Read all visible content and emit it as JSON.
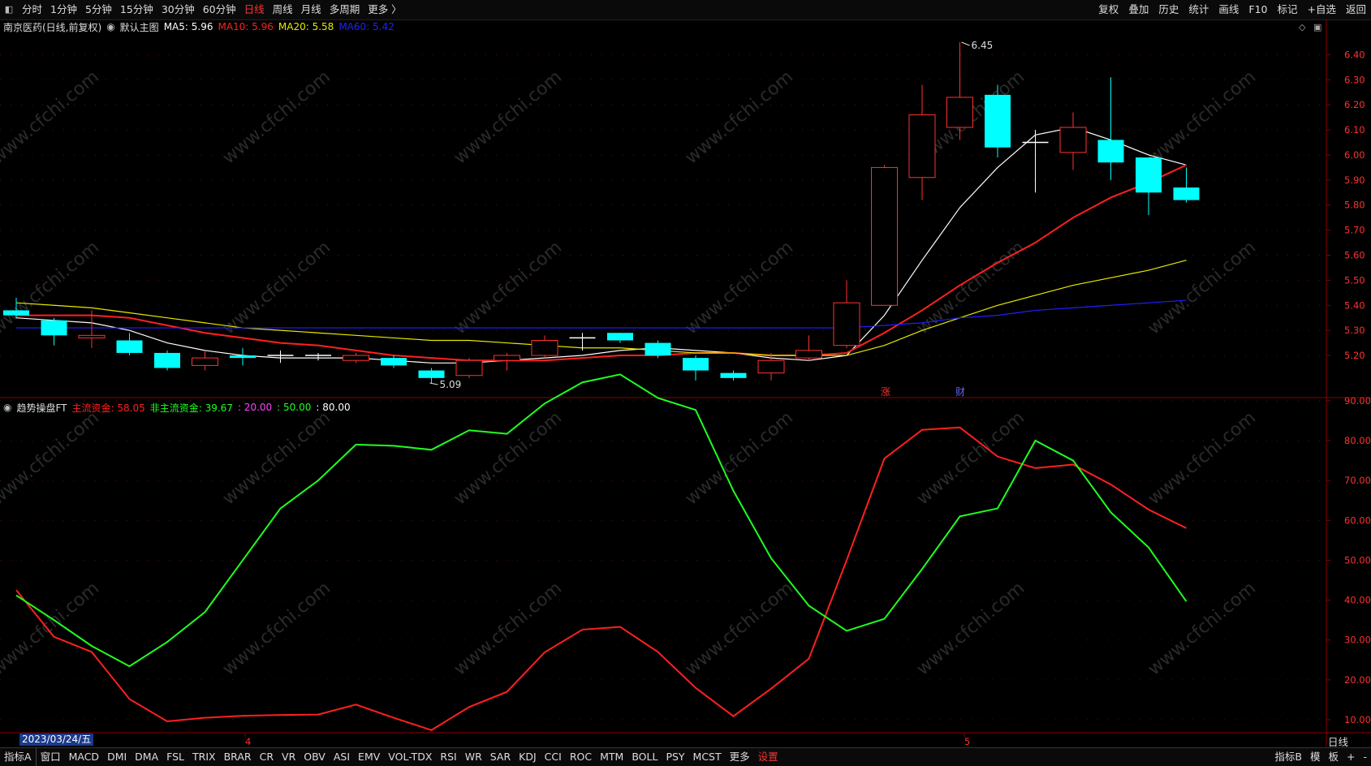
{
  "toolbar": {
    "periods": [
      "分时",
      "1分钟",
      "5分钟",
      "15分钟",
      "30分钟",
      "60分钟",
      "日线",
      "周线",
      "月线",
      "多周期",
      "更多"
    ],
    "active_period": "日线",
    "right_items": [
      "复权",
      "叠加",
      "历史",
      "统计",
      "画线",
      "F10",
      "标记",
      "+自选",
      "返回"
    ]
  },
  "main_legend": {
    "stock": "南京医药(日线,前复权)",
    "template": "默认主图",
    "ma5_label": "MA5: 5.96",
    "ma10_label": "MA10: 5.96",
    "ma20_label": "MA20: 5.58",
    "ma60_label": "MA60: 5.42"
  },
  "sub_legend": {
    "name": "趋势操盘FT",
    "main_fund": "主流资金: 58.05",
    "non_main_fund": "非主流资金: 39.67",
    "lvl1": ": 20.00",
    "lvl2": ": 50.00",
    "lvl3": ": 80.00"
  },
  "bottom_tabs": [
    "指标A",
    "窗口",
    "MACD",
    "DMI",
    "DMA",
    "FSL",
    "TRIX",
    "BRAR",
    "CR",
    "VR",
    "OBV",
    "ASI",
    "EMV",
    "VOL-TDX",
    "RSI",
    "WR",
    "SAR",
    "KDJ",
    "CCI",
    "ROC",
    "MTM",
    "BOLL",
    "PSY",
    "MCST",
    "更多",
    "设置"
  ],
  "bottom_right": [
    "指标B",
    "模",
    "板",
    "+",
    "-"
  ],
  "period_label": "日线",
  "date_box": "2023/03/24/五",
  "watermark": "www.cfchi.com",
  "colors": {
    "up": "#ff3232",
    "down": "#00ffff",
    "ma5": "#ffffff",
    "ma10": "#ff2020",
    "ma20": "#e8e800",
    "ma60": "#2020ff",
    "main_fund": "#ff2020",
    "non_main": "#20ff20"
  },
  "chart_data": [
    {
      "type": "candlestick",
      "ylim": [
        5.09,
        6.45
      ],
      "y_ticks": [
        5.2,
        5.3,
        5.4,
        5.5,
        5.6,
        5.7,
        5.8,
        5.9,
        6.0,
        6.1,
        6.2,
        6.3,
        6.4
      ],
      "month_markers": [
        "4",
        "5"
      ],
      "annotations": {
        "high": "6.45",
        "low": "5.09",
        "tag1": "涨",
        "tag2": "财"
      },
      "candles": [
        {
          "o": 5.38,
          "c": 5.36,
          "h": 5.43,
          "l": 5.35
        },
        {
          "o": 5.34,
          "c": 5.28,
          "h": 5.35,
          "l": 5.24
        },
        {
          "o": 5.27,
          "c": 5.28,
          "h": 5.38,
          "l": 5.23
        },
        {
          "o": 5.26,
          "c": 5.21,
          "h": 5.29,
          "l": 5.2
        },
        {
          "o": 5.21,
          "c": 5.15,
          "h": 5.22,
          "l": 5.14
        },
        {
          "o": 5.16,
          "c": 5.19,
          "h": 5.22,
          "l": 5.14
        },
        {
          "o": 5.2,
          "c": 5.19,
          "h": 5.23,
          "l": 5.16
        },
        {
          "o": 5.2,
          "c": 5.2,
          "h": 5.22,
          "l": 5.17
        },
        {
          "o": 5.2,
          "c": 5.2,
          "h": 5.21,
          "l": 5.18
        },
        {
          "o": 5.18,
          "c": 5.2,
          "h": 5.21,
          "l": 5.17
        },
        {
          "o": 5.19,
          "c": 5.16,
          "h": 5.2,
          "l": 5.15
        },
        {
          "o": 5.14,
          "c": 5.11,
          "h": 5.15,
          "l": 5.09
        },
        {
          "o": 5.12,
          "c": 5.18,
          "h": 5.19,
          "l": 5.11
        },
        {
          "o": 5.18,
          "c": 5.2,
          "h": 5.21,
          "l": 5.14
        },
        {
          "o": 5.2,
          "c": 5.26,
          "h": 5.28,
          "l": 5.19
        },
        {
          "o": 5.27,
          "c": 5.27,
          "h": 5.29,
          "l": 5.22
        },
        {
          "o": 5.29,
          "c": 5.26,
          "h": 5.29,
          "l": 5.25
        },
        {
          "o": 5.25,
          "c": 5.2,
          "h": 5.26,
          "l": 5.19
        },
        {
          "o": 5.19,
          "c": 5.14,
          "h": 5.2,
          "l": 5.1
        },
        {
          "o": 5.13,
          "c": 5.11,
          "h": 5.14,
          "l": 5.1
        },
        {
          "o": 5.13,
          "c": 5.18,
          "h": 5.21,
          "l": 5.1
        },
        {
          "o": 5.19,
          "c": 5.22,
          "h": 5.28,
          "l": 5.18
        },
        {
          "o": 5.24,
          "c": 5.41,
          "h": 5.5,
          "l": 5.23
        },
        {
          "o": 5.4,
          "c": 5.95,
          "h": 5.96,
          "l": 5.4
        },
        {
          "o": 5.91,
          "c": 6.16,
          "h": 6.28,
          "l": 5.82
        },
        {
          "o": 6.11,
          "c": 6.23,
          "h": 6.45,
          "l": 6.06
        },
        {
          "o": 6.24,
          "c": 6.03,
          "h": 6.28,
          "l": 5.99
        },
        {
          "o": 6.05,
          "c": 6.05,
          "h": 6.1,
          "l": 5.85
        },
        {
          "o": 6.01,
          "c": 6.11,
          "h": 6.17,
          "l": 5.94
        },
        {
          "o": 6.06,
          "c": 5.97,
          "h": 6.31,
          "l": 5.9
        },
        {
          "o": 5.99,
          "c": 5.85,
          "h": 5.99,
          "l": 5.76
        },
        {
          "o": 5.87,
          "c": 5.82,
          "h": 5.95,
          "l": 5.81
        }
      ],
      "series": [
        {
          "values": [
            5.35,
            5.34,
            5.33,
            5.3,
            5.25,
            5.22,
            5.2,
            5.19,
            5.19,
            5.19,
            5.18,
            5.17,
            5.17,
            5.18,
            5.19,
            5.2,
            5.22,
            5.23,
            5.22,
            5.21,
            5.19,
            5.18,
            5.2,
            5.36,
            5.58,
            5.79,
            5.95,
            6.08,
            6.11,
            6.06,
            6.0,
            5.96
          ]
        },
        {
          "values": [
            5.36,
            5.36,
            5.36,
            5.35,
            5.32,
            5.29,
            5.27,
            5.25,
            5.24,
            5.22,
            5.2,
            5.19,
            5.18,
            5.18,
            5.18,
            5.19,
            5.2,
            5.2,
            5.21,
            5.21,
            5.2,
            5.2,
            5.21,
            5.29,
            5.38,
            5.48,
            5.57,
            5.65,
            5.75,
            5.83,
            5.89,
            5.96
          ]
        },
        {
          "values": [
            5.41,
            5.4,
            5.39,
            5.37,
            5.35,
            5.33,
            5.31,
            5.3,
            5.29,
            5.28,
            5.27,
            5.26,
            5.26,
            5.25,
            5.24,
            5.23,
            5.23,
            5.22,
            5.21,
            5.21,
            5.2,
            5.2,
            5.2,
            5.24,
            5.3,
            5.35,
            5.4,
            5.44,
            5.48,
            5.51,
            5.54,
            5.58
          ]
        },
        {
          "values": [
            5.31,
            5.31,
            5.31,
            5.31,
            5.31,
            5.31,
            5.31,
            5.31,
            5.31,
            5.31,
            5.31,
            5.31,
            5.31,
            5.31,
            5.31,
            5.31,
            5.31,
            5.31,
            5.31,
            5.31,
            5.31,
            5.31,
            5.31,
            5.32,
            5.33,
            5.35,
            5.36,
            5.38,
            5.39,
            5.4,
            5.41,
            5.42
          ]
        }
      ]
    },
    {
      "type": "line",
      "ylim": [
        5,
        100
      ],
      "y_ticks": [
        10,
        20,
        30,
        40,
        50,
        60,
        70,
        80,
        90
      ],
      "ref_lines": [
        20,
        50,
        80
      ],
      "series": [
        {
          "values": [
            42.5,
            30.8,
            27.0,
            15.2,
            9.6,
            10.5,
            11.0,
            11.2,
            11.3,
            13.8,
            10.5,
            7.4,
            13.2,
            17.0,
            26.9,
            32.6,
            33.3,
            27.0,
            18.0,
            10.9,
            17.8,
            25.3,
            50.0,
            75.5,
            82.7,
            83.3,
            76.0,
            73.1,
            74.0,
            69.0,
            62.7,
            58.05
          ]
        },
        {
          "values": [
            41.2,
            35.0,
            28.5,
            23.4,
            29.5,
            37.0,
            50.0,
            63.0,
            70.0,
            79.0,
            78.7,
            77.7,
            82.6,
            81.7,
            89.3,
            94.6,
            96.6,
            90.7,
            87.7,
            67.4,
            50.5,
            38.6,
            32.3,
            35.3,
            47.8,
            61.0,
            63.0,
            80.0,
            75.0,
            62.0,
            53.2,
            39.67
          ]
        }
      ]
    }
  ]
}
